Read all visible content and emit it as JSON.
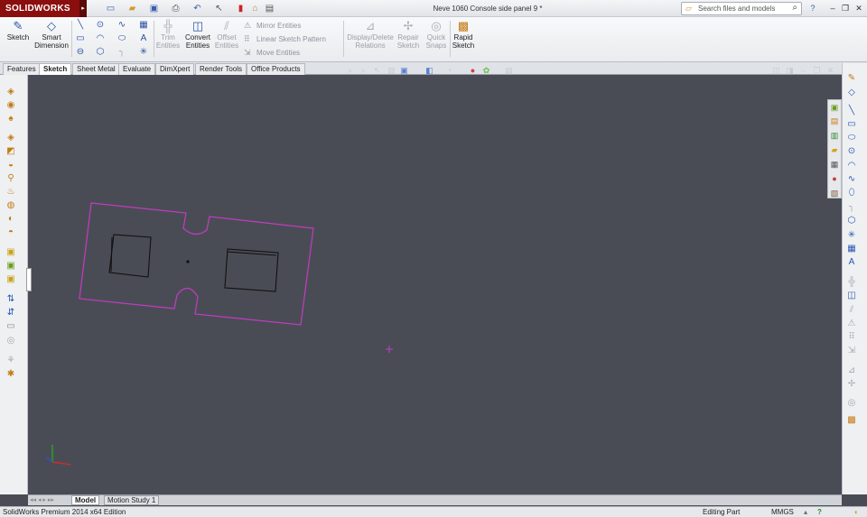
{
  "app": {
    "logo": "SOLIDWORKS",
    "title": "Neve 1060 Console side panel 9 *"
  },
  "search": {
    "placeholder": "Search files and models"
  },
  "commands": {
    "sketch": "Sketch",
    "smart_dimension_1": "Smart",
    "smart_dimension_2": "Dimension",
    "trim_1": "Trim",
    "trim_2": "Entities",
    "convert_1": "Convert",
    "convert_2": "Entities",
    "offset_1": "Offset",
    "offset_2": "Entities",
    "mirror": "Mirror Entities",
    "linear_pattern": "Linear Sketch Pattern",
    "move": "Move Entities",
    "display_delete_1": "Display/Delete",
    "display_delete_2": "Relations",
    "repair_1": "Repair",
    "repair_2": "Sketch",
    "quick_snaps_1": "Quick",
    "quick_snaps_2": "Snaps",
    "rapid_sketch_1": "Rapid",
    "rapid_sketch_2": "Sketch"
  },
  "tabs": [
    "Features",
    "Sketch",
    "Sheet Metal",
    "Evaluate",
    "DimXpert",
    "Render Tools",
    "Office Products"
  ],
  "active_tab": "Sketch",
  "bottom_tabs": [
    "Model",
    "Motion Study 1"
  ],
  "status": {
    "edition": "SolidWorks Premium 2014 x64 Edition",
    "mode": "Editing Part",
    "units": "MMGS"
  },
  "colors": {
    "sketch_line": "#c23cc2",
    "cut_line": "#111111",
    "origin": "#c23cc2",
    "viewport_bg": "#4a4c55",
    "accent": "#8b0e0e"
  }
}
